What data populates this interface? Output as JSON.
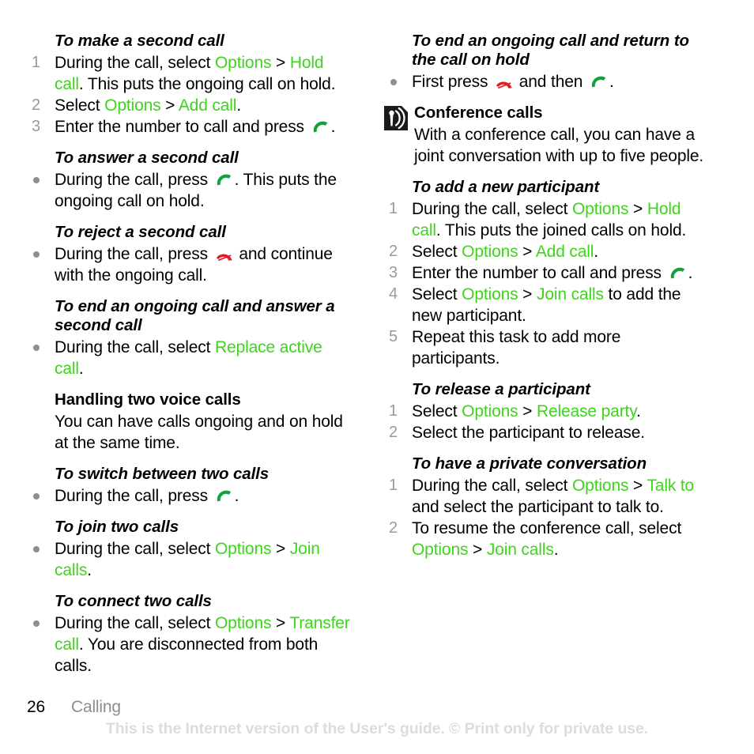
{
  "page": {
    "number": "26",
    "chapter": "Calling",
    "watermark": "This is the Internet version of the User's guide. © Print only for private use."
  },
  "colors": {
    "ui_label_green": "#3fd41c",
    "call_key_green": "#12a23c",
    "end_key_red": "#e01b24",
    "marker_grey": "#9a9a9a",
    "watermark_grey": "#dcdcdc"
  },
  "icons": {
    "call_key": "green-call-key-icon",
    "end_key": "red-end-call-key-icon",
    "tip": "conference-broadcast-tip-icon"
  },
  "left_column": {
    "blocks": [
      {
        "id": "make-second-call",
        "heading": "To make a second call",
        "heading_style": "italic",
        "list_type": "ordered",
        "items": [
          {
            "num": "1",
            "parts": [
              {
                "t": "During the call, select ",
                "s": "plain"
              },
              {
                "t": "Options",
                "s": "ui"
              },
              {
                "t": " > ",
                "s": "plain"
              },
              {
                "t": "Hold call",
                "s": "ui"
              },
              {
                "t": ". This puts the ongoing call on hold.",
                "s": "plain"
              }
            ]
          },
          {
            "num": "2",
            "parts": [
              {
                "t": "Select ",
                "s": "plain"
              },
              {
                "t": "Options",
                "s": "ui"
              },
              {
                "t": " > ",
                "s": "plain"
              },
              {
                "t": "Add call",
                "s": "ui"
              },
              {
                "t": ".",
                "s": "plain"
              }
            ]
          },
          {
            "num": "3",
            "parts": [
              {
                "t": "Enter the number to call and press ",
                "s": "plain"
              },
              {
                "t": "",
                "s": "icon-call"
              },
              {
                "t": ".",
                "s": "plain"
              }
            ]
          }
        ]
      },
      {
        "id": "answer-second-call",
        "heading": "To answer a second call",
        "heading_style": "italic",
        "list_type": "bullet",
        "items": [
          {
            "num": "",
            "parts": [
              {
                "t": "During the call, press ",
                "s": "plain"
              },
              {
                "t": "",
                "s": "icon-call"
              },
              {
                "t": ". This puts the ongoing call on hold.",
                "s": "plain"
              }
            ]
          }
        ]
      },
      {
        "id": "reject-second-call",
        "heading": "To reject a second call",
        "heading_style": "italic",
        "list_type": "bullet",
        "items": [
          {
            "num": "",
            "parts": [
              {
                "t": "During the call, press ",
                "s": "plain"
              },
              {
                "t": "",
                "s": "icon-end"
              },
              {
                "t": " and continue with the ongoing call.",
                "s": "plain"
              }
            ]
          }
        ]
      },
      {
        "id": "end-ongoing-answer-second",
        "heading": "To end an ongoing call and answer a second call",
        "heading_style": "italic",
        "list_type": "bullet",
        "items": [
          {
            "num": "",
            "parts": [
              {
                "t": "During the call, select ",
                "s": "plain"
              },
              {
                "t": "Replace active call",
                "s": "ui"
              },
              {
                "t": ".",
                "s": "plain"
              }
            ]
          }
        ]
      },
      {
        "id": "handling-two-voice-calls",
        "heading": "Handling two voice calls",
        "heading_style": "normal",
        "list_type": "paragraph",
        "paragraph": "You can have calls ongoing and on hold at the same time."
      },
      {
        "id": "switch-between-two-calls",
        "heading": "To switch between two calls",
        "heading_style": "italic",
        "list_type": "bullet",
        "items": [
          {
            "num": "",
            "parts": [
              {
                "t": "During the call, press ",
                "s": "plain"
              },
              {
                "t": "",
                "s": "icon-call"
              },
              {
                "t": ".",
                "s": "plain"
              }
            ]
          }
        ]
      },
      {
        "id": "join-two-calls",
        "heading": "To join two calls",
        "heading_style": "italic",
        "list_type": "bullet",
        "items": [
          {
            "num": "",
            "parts": [
              {
                "t": "During the call, select ",
                "s": "plain"
              },
              {
                "t": "Options",
                "s": "ui"
              },
              {
                "t": " > ",
                "s": "plain"
              },
              {
                "t": "Join calls",
                "s": "ui"
              },
              {
                "t": ".",
                "s": "plain"
              }
            ]
          }
        ]
      },
      {
        "id": "connect-two-calls",
        "heading": "To connect two calls",
        "heading_style": "italic",
        "list_type": "bullet",
        "items": [
          {
            "num": "",
            "parts": [
              {
                "t": "During the call, select ",
                "s": "plain"
              },
              {
                "t": "Options",
                "s": "ui"
              },
              {
                "t": " > ",
                "s": "plain"
              },
              {
                "t": "Transfer call",
                "s": "ui"
              },
              {
                "t": ". You are disconnected from both calls.",
                "s": "plain"
              }
            ]
          }
        ]
      }
    ]
  },
  "right_column": {
    "blocks": [
      {
        "id": "end-ongoing-return-hold",
        "heading": "To end an ongoing call and return to the call on hold",
        "heading_style": "italic",
        "list_type": "bullet",
        "items": [
          {
            "num": "",
            "parts": [
              {
                "t": "First press ",
                "s": "plain"
              },
              {
                "t": "",
                "s": "icon-end"
              },
              {
                "t": " and then ",
                "s": "plain"
              },
              {
                "t": "",
                "s": "icon-call"
              },
              {
                "t": ".",
                "s": "plain"
              }
            ]
          }
        ]
      },
      {
        "id": "conference-calls",
        "heading": "Conference calls",
        "heading_style": "normal",
        "has_tip_icon": true,
        "list_type": "paragraph",
        "paragraph": "With a conference call, you can have a joint conversation with up to five people."
      },
      {
        "id": "add-new-participant",
        "heading": "To add a new participant",
        "heading_style": "italic",
        "list_type": "ordered",
        "items": [
          {
            "num": "1",
            "parts": [
              {
                "t": "During the call, select ",
                "s": "plain"
              },
              {
                "t": "Options",
                "s": "ui"
              },
              {
                "t": " > ",
                "s": "plain"
              },
              {
                "t": "Hold call",
                "s": "ui"
              },
              {
                "t": ". This puts the joined calls on hold.",
                "s": "plain"
              }
            ]
          },
          {
            "num": "2",
            "parts": [
              {
                "t": "Select ",
                "s": "plain"
              },
              {
                "t": "Options",
                "s": "ui"
              },
              {
                "t": " > ",
                "s": "plain"
              },
              {
                "t": "Add call",
                "s": "ui"
              },
              {
                "t": ".",
                "s": "plain"
              }
            ]
          },
          {
            "num": "3",
            "parts": [
              {
                "t": "Enter the number to call and press ",
                "s": "plain"
              },
              {
                "t": "",
                "s": "icon-call"
              },
              {
                "t": ".",
                "s": "plain"
              }
            ]
          },
          {
            "num": "4",
            "parts": [
              {
                "t": "Select ",
                "s": "plain"
              },
              {
                "t": "Options",
                "s": "ui"
              },
              {
                "t": " > ",
                "s": "plain"
              },
              {
                "t": "Join calls",
                "s": "ui"
              },
              {
                "t": " to add the new participant.",
                "s": "plain"
              }
            ]
          },
          {
            "num": "5",
            "parts": [
              {
                "t": "Repeat this task to add more participants.",
                "s": "plain"
              }
            ]
          }
        ]
      },
      {
        "id": "release-participant",
        "heading": "To release a participant",
        "heading_style": "italic",
        "list_type": "ordered",
        "items": [
          {
            "num": "1",
            "parts": [
              {
                "t": "Select ",
                "s": "plain"
              },
              {
                "t": "Options",
                "s": "ui"
              },
              {
                "t": " > ",
                "s": "plain"
              },
              {
                "t": "Release party",
                "s": "ui"
              },
              {
                "t": ".",
                "s": "plain"
              }
            ]
          },
          {
            "num": "2",
            "parts": [
              {
                "t": "Select the participant to release.",
                "s": "plain"
              }
            ]
          }
        ]
      },
      {
        "id": "private-conversation",
        "heading": "To have a private conversation",
        "heading_style": "italic",
        "list_type": "ordered",
        "items": [
          {
            "num": "1",
            "parts": [
              {
                "t": "During the call, select ",
                "s": "plain"
              },
              {
                "t": "Options",
                "s": "ui"
              },
              {
                "t": " > ",
                "s": "plain"
              },
              {
                "t": "Talk to",
                "s": "ui"
              },
              {
                "t": " and select the participant to talk to.",
                "s": "plain"
              }
            ]
          },
          {
            "num": "2",
            "parts": [
              {
                "t": "To resume the conference call, select ",
                "s": "plain"
              },
              {
                "t": "Options",
                "s": "ui"
              },
              {
                "t": " > ",
                "s": "plain"
              },
              {
                "t": "Join calls",
                "s": "ui"
              },
              {
                "t": ".",
                "s": "plain"
              }
            ]
          }
        ]
      }
    ]
  }
}
